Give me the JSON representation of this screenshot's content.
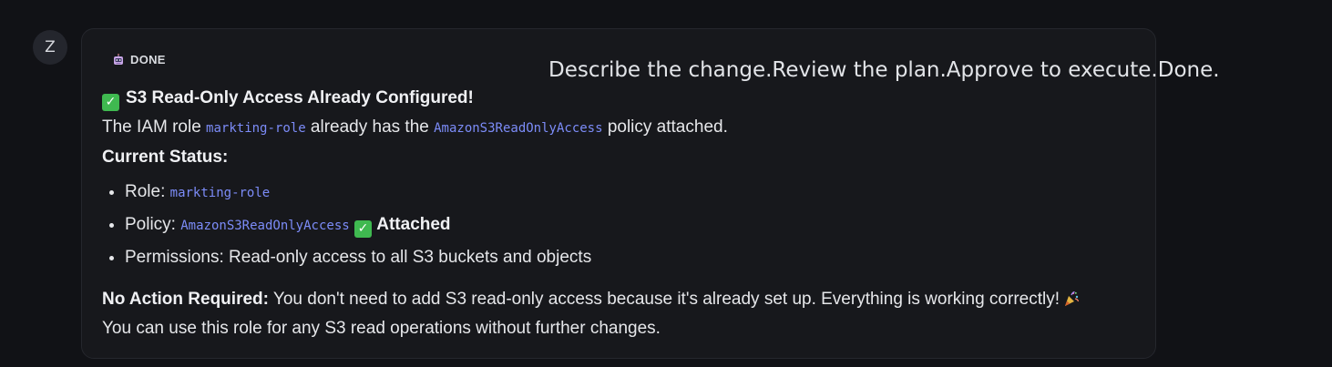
{
  "avatar": {
    "initial": "Z"
  },
  "status": {
    "label": "DONE",
    "icon": "robot-icon"
  },
  "tagline": "Describe the change.Review the plan.Approve to execute.Done.",
  "message": {
    "heading": "S3 Read-Only Access Already Configured!",
    "intro": {
      "pre": "The IAM role ",
      "role": "markting-role",
      "mid": " already has the ",
      "policy": "AmazonS3ReadOnlyAccess",
      "post": " policy attached."
    },
    "status_heading": "Current Status:",
    "items": {
      "role_label": "Role: ",
      "role_value": "markting-role",
      "policy_label": "Policy: ",
      "policy_value": "AmazonS3ReadOnlyAccess",
      "policy_state": "Attached",
      "permissions": "Permissions: Read-only access to all S3 buckets and objects"
    },
    "note": {
      "label": "No Action Required:",
      "text": " You don't need to add S3 read-only access because it's already set up. Everything is working correctly!"
    },
    "footer": "You can use this role for any S3 read operations without further changes."
  },
  "colors": {
    "background": "#111216",
    "card": "#17181c",
    "code": "#7c8cf8",
    "check": "#3fb950"
  }
}
